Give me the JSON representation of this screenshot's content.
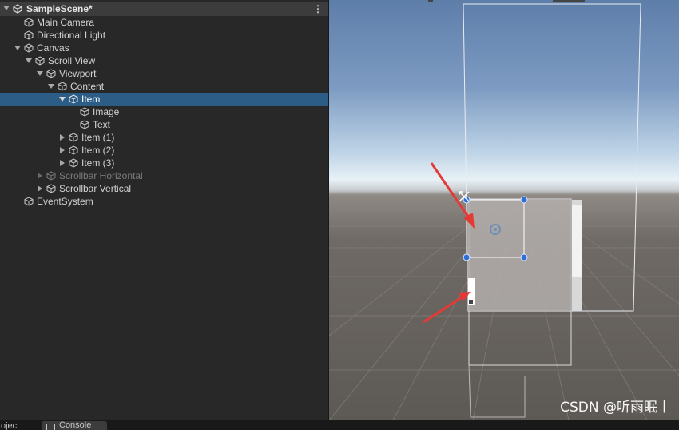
{
  "hierarchy": {
    "scene_name": "SampleScene*",
    "items": [
      {
        "label": "Main Camera"
      },
      {
        "label": "Directional Light"
      },
      {
        "label": "Canvas"
      },
      {
        "label": "Scroll View"
      },
      {
        "label": "Viewport"
      },
      {
        "label": "Content"
      },
      {
        "label": "Item"
      },
      {
        "label": "Image"
      },
      {
        "label": "Text"
      },
      {
        "label": "Item (1)"
      },
      {
        "label": "Item (2)"
      },
      {
        "label": "Item (3)"
      },
      {
        "label": "Scrollbar Horizontal"
      },
      {
        "label": "Scrollbar Vertical"
      },
      {
        "label": "EventSystem"
      }
    ]
  },
  "bottom_tabs": {
    "project": "Project",
    "console": "Console"
  },
  "scene_view": {
    "watermark": "CSDN @听雨眠丨"
  },
  "colors": {
    "selection": "#2c5d87",
    "handle_blue": "#2f6fd6",
    "arrow_red": "#e53935"
  }
}
